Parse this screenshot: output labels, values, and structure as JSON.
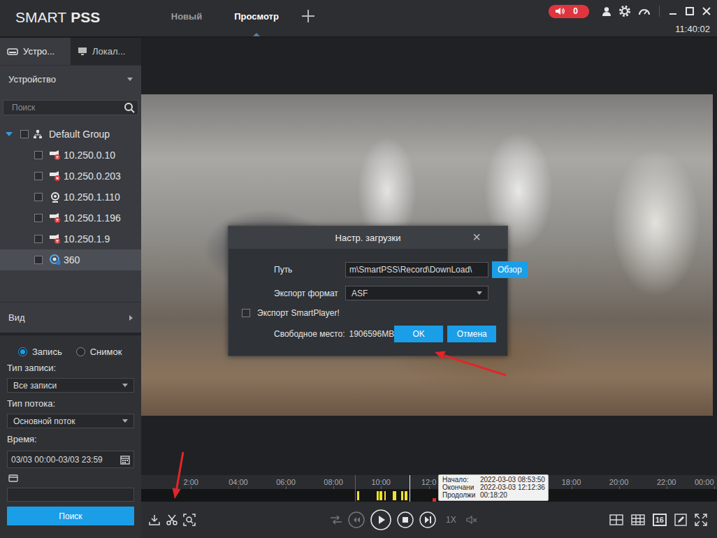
{
  "header": {
    "logo": {
      "light": "SMART",
      "bold": "PSS"
    },
    "tabs": [
      {
        "label": "Новый",
        "selected": false
      },
      {
        "label": "Просмотр",
        "selected": true
      }
    ],
    "alarm": {
      "count": "0"
    },
    "clock": "11:40:02"
  },
  "sidebar": {
    "tabs": [
      {
        "label": "Устро...",
        "selected": true
      },
      {
        "label": "Локал...",
        "selected": false
      }
    ],
    "section": {
      "label": "Устройство",
      "expanded": true
    },
    "search": {
      "placeholder": "Поиск"
    },
    "tree": {
      "group": {
        "label": "Default Group",
        "expanded": true,
        "checked": false
      },
      "devices": [
        {
          "label": "10.250.0.10",
          "kind": "offline",
          "checked": false,
          "selected": false
        },
        {
          "label": "10.250.0.203",
          "kind": "offline",
          "checked": false,
          "selected": false
        },
        {
          "label": "10.250.1.110",
          "kind": "online",
          "checked": false,
          "selected": false
        },
        {
          "label": "10.250.1.196",
          "kind": "offline",
          "checked": false,
          "selected": false
        },
        {
          "label": "10.250.1.9",
          "kind": "offline",
          "checked": false,
          "selected": false
        },
        {
          "label": "360",
          "kind": "fisheye",
          "checked": false,
          "selected": true
        }
      ]
    },
    "view": {
      "label": "Вид",
      "expanded": false
    },
    "modes": [
      {
        "label": "Запись",
        "selected": true
      },
      {
        "label": "Снимок",
        "selected": false
      }
    ],
    "fields": [
      {
        "label": "Тип записи:",
        "value": "Все записи",
        "kind": "dropdown"
      },
      {
        "label": "Тип потока:",
        "value": "Основной поток",
        "kind": "dropdown"
      },
      {
        "label": "Время:",
        "value": "03/03 00:00-03/03 23:59",
        "kind": "date"
      }
    ],
    "search_button": "Поиск"
  },
  "player": {
    "timeline": {
      "ticks": [
        {
          "label": "2:00",
          "hour": 2
        },
        {
          "label": "04:00",
          "hour": 4
        },
        {
          "label": "06:00",
          "hour": 6
        },
        {
          "label": "08:00",
          "hour": 8
        },
        {
          "label": "10:00",
          "hour": 10
        },
        {
          "label": "12:0",
          "hour": 12
        },
        {
          "label": "18:00",
          "hour": 18
        },
        {
          "label": "20:00",
          "hour": 20
        },
        {
          "label": "22:00",
          "hour": 22
        },
        {
          "label": "00:00",
          "hour": 24
        }
      ],
      "segments": [
        [
          9.0,
          9.09
        ],
        [
          9.82,
          9.9
        ],
        [
          9.94,
          10.06
        ],
        [
          10.12,
          10.2
        ],
        [
          10.5,
          10.62
        ],
        [
          10.85,
          10.94
        ],
        [
          11.0,
          11.1
        ]
      ],
      "selection": {
        "start": 8.9,
        "end": 12.21
      },
      "cursor": 11.18,
      "tooltip": [
        {
          "label": "Начало:",
          "value": "2022-03-03 08:53:50"
        },
        {
          "label": "Окончани",
          "value": "2022-03-03 12:12:36"
        },
        {
          "label": "Продолжи",
          "value": "00:18:20"
        }
      ]
    },
    "speed": "1X",
    "layout_count": "16"
  },
  "dialog": {
    "title": "Настр. загрузки",
    "close": "×",
    "path": {
      "label": "Путь",
      "value": "m\\SmartPSS\\Record\\DownLoad\\",
      "browse": "Обзор"
    },
    "format": {
      "label": "Экспорт формат",
      "value": "ASF"
    },
    "smartplayer": {
      "label": "Экспорт SmartPlayer!",
      "checked": false
    },
    "free_space": {
      "label": "Свободное место:",
      "value": "1906596MB"
    },
    "buttons": [
      {
        "label": "OK"
      },
      {
        "label": "Отмена"
      }
    ]
  }
}
